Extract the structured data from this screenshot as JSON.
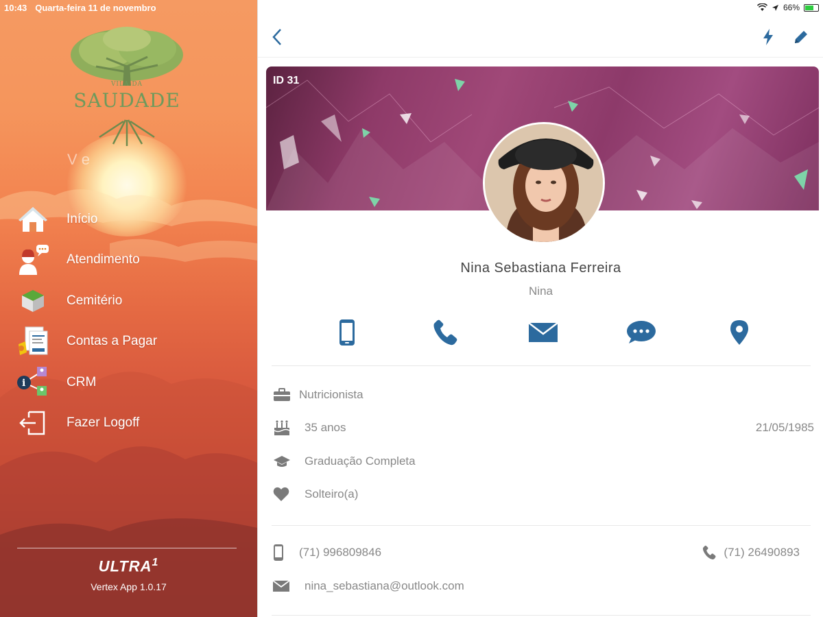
{
  "status": {
    "time": "10:43",
    "date": "Quarta-feira 11 de novembro",
    "battery": "66%",
    "battery_level": 0.66
  },
  "sidebar": {
    "logo_line1": "VILA DA",
    "logo_line2": "SAUDADE",
    "faded_text": "V                   e",
    "menu": [
      {
        "label": "Início",
        "icon": "home-icon"
      },
      {
        "label": "Atendimento",
        "icon": "attendant-icon"
      },
      {
        "label": "Cemitério",
        "icon": "cemetery-icon"
      },
      {
        "label": "Contas a Pagar",
        "icon": "bills-icon"
      },
      {
        "label": "CRM",
        "icon": "crm-icon"
      },
      {
        "label": "Fazer Logoff",
        "icon": "logoff-icon"
      }
    ],
    "brand": "ULTRA",
    "brand_sup": "1",
    "version": "Vertex App 1.0.17"
  },
  "profile": {
    "id_label": "ID 31",
    "name": "Nina Sebastiana Ferreira",
    "nickname": "Nina",
    "actions": [
      "mobile-icon",
      "phone-icon",
      "email-icon",
      "chat-icon",
      "location-icon"
    ],
    "profession": "Nutricionista",
    "age": "35 anos",
    "birthdate": "21/05/1985",
    "education": "Graduação Completa",
    "marital_status": "Solteiro(a)",
    "mobile": "(71) 996809846",
    "phone": "(71) 26490893",
    "email": "nina_sebastiana@outlook.com"
  },
  "colors": {
    "accent": "#2c6a9e",
    "icon_gray": "#7a7a7a"
  }
}
